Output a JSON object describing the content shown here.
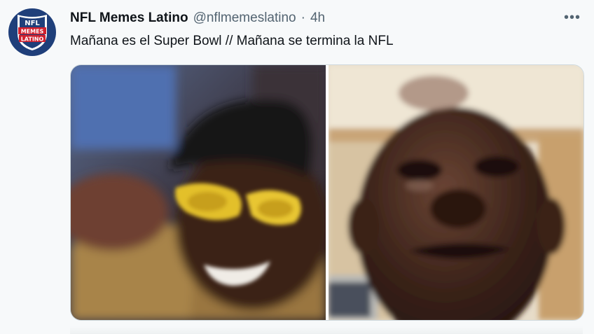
{
  "tweet": {
    "display_name": "NFL Memes Latino",
    "handle": "@nflmemeslatino",
    "separator": "·",
    "time": "4h",
    "text": "Mañana es el Super Bowl // Mañana se termina la NFL",
    "more_icon": "more-horizontal-icon"
  },
  "avatar": {
    "logo_lines": [
      "NFL",
      "MEMES",
      "LATINO"
    ],
    "colors": {
      "background": "#1f3f7a",
      "red": "#d0202e",
      "white": "#ffffff"
    }
  },
  "media": {
    "images": [
      {
        "name": "happy-meme-image"
      },
      {
        "name": "crying-meme-image"
      }
    ]
  },
  "colors": {
    "text_primary": "#0f1419",
    "text_secondary": "#536471",
    "background": "#f7f9fa",
    "border": "#cfd9de"
  }
}
